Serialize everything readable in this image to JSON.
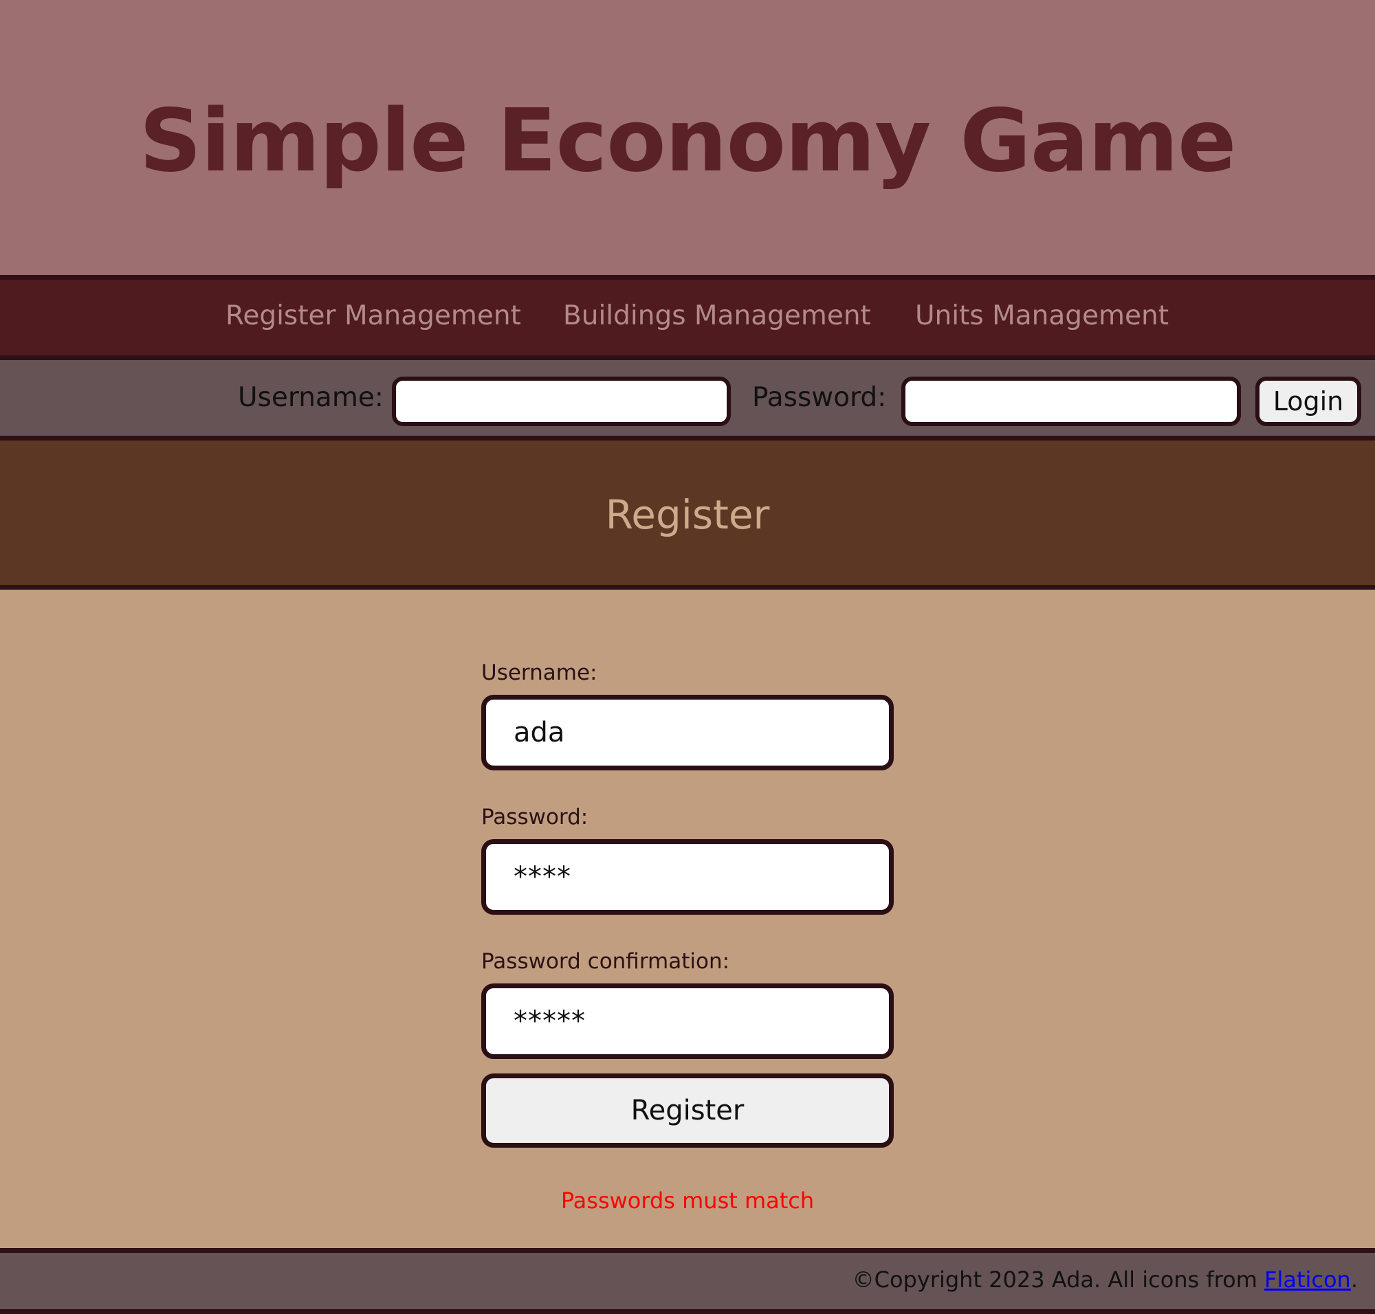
{
  "header": {
    "title": "Simple Economy Game"
  },
  "nav": {
    "items": [
      {
        "label": "Register Management"
      },
      {
        "label": "Buildings Management"
      },
      {
        "label": "Units Management"
      }
    ]
  },
  "login_bar": {
    "username_label": "Username:",
    "username_value": "",
    "password_label": "Password:",
    "password_value": "",
    "login_label": "Login"
  },
  "register": {
    "heading": "Register",
    "username_label": "Username:",
    "username_value": "ada",
    "password_label": "Password:",
    "password_display": "****",
    "confirm_label": "Password confirmation:",
    "confirm_display": "*****",
    "submit_label": "Register",
    "error_message": "Passwords must match"
  },
  "footer": {
    "text": "©Copyright 2023 Ada. All icons from ",
    "link_label": "Flaticon",
    "trailing": "."
  },
  "colors": {
    "header_bg": "#9e6f70",
    "title": "#5a2226",
    "nav_bg": "#4f1b1f",
    "nav_text": "#b28a8b",
    "login_bar_bg": "#665355",
    "register_band_bg": "#5c3824",
    "register_heading": "#ccab8c",
    "main_bg": "#c29e81",
    "error": "#ff0000",
    "link": "#0000ee"
  }
}
